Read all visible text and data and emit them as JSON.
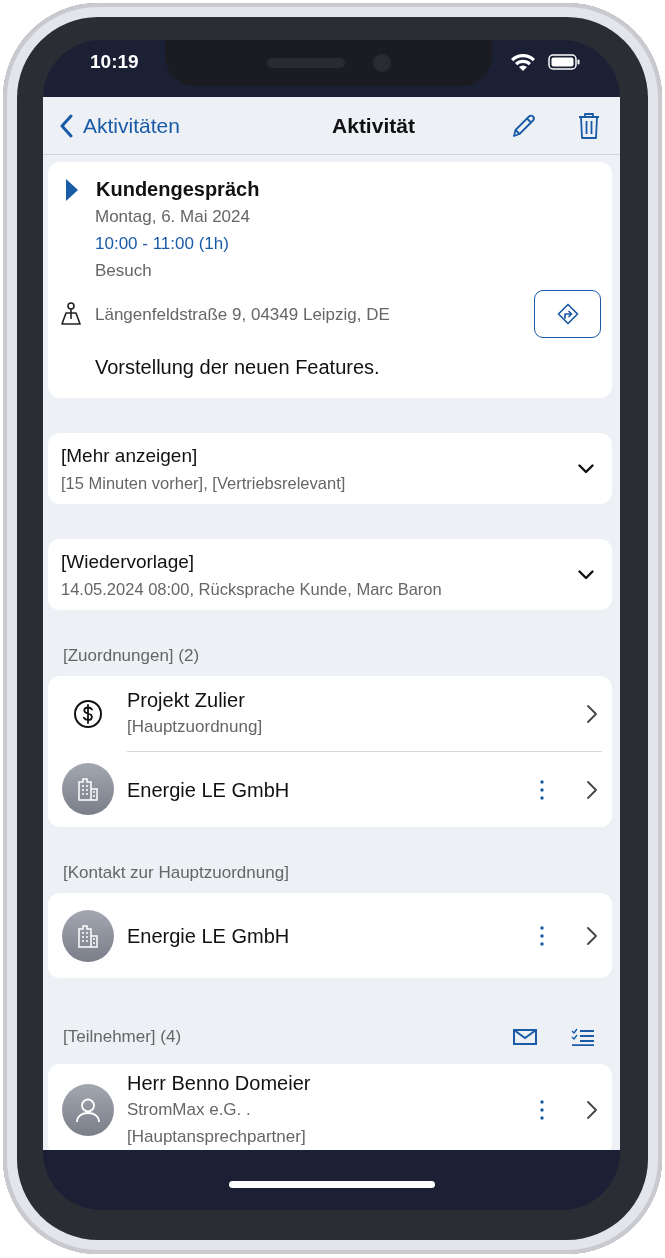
{
  "status_bar": {
    "time": "10:19"
  },
  "nav": {
    "back_label": "Aktivitäten",
    "title": "Aktivität"
  },
  "activity": {
    "title": "Kundengespräch",
    "date": "Montag, 6. Mai 2024",
    "time_range": "10:00 - 11:00 (1h)",
    "type": "Besuch",
    "address": "Längenfeldstraße 9, 04349 Leipzig, DE",
    "description": "Vorstellung der neuen Features."
  },
  "collapsibles": [
    {
      "title": "[Mehr anzeigen]",
      "subtitle": "[15 Minuten vorher], [Vertriebsrelevant]",
      "expanded": false
    },
    {
      "title": "[Wiedervorlage]",
      "subtitle": "14.05.2024 08:00, Rücksprache Kunde, Marc Baron",
      "expanded": false
    }
  ],
  "sections": [
    {
      "kind": "assignments",
      "header": "[Zuordnungen] (2)",
      "items": [
        {
          "kind": "project",
          "title": "Projekt Zulier",
          "subtitles": [
            "[Hauptzuordnung]"
          ],
          "menu": false
        },
        {
          "kind": "company",
          "title": "Energie LE GmbH",
          "menu": true
        }
      ]
    },
    {
      "kind": "contact",
      "header": "[Kontakt zur Hauptzuordnung]",
      "items": [
        {
          "kind": "company",
          "title": "Energie LE GmbH",
          "menu": true
        }
      ]
    },
    {
      "kind": "participants",
      "header": "[Teilnehmer] (4)",
      "items": [
        {
          "kind": "person",
          "title": "Herr Benno Domeier",
          "subtitles": [
            "StromMax e.G. .",
            "[Hauptansprechpartner]"
          ],
          "menu": true
        }
      ]
    }
  ]
}
